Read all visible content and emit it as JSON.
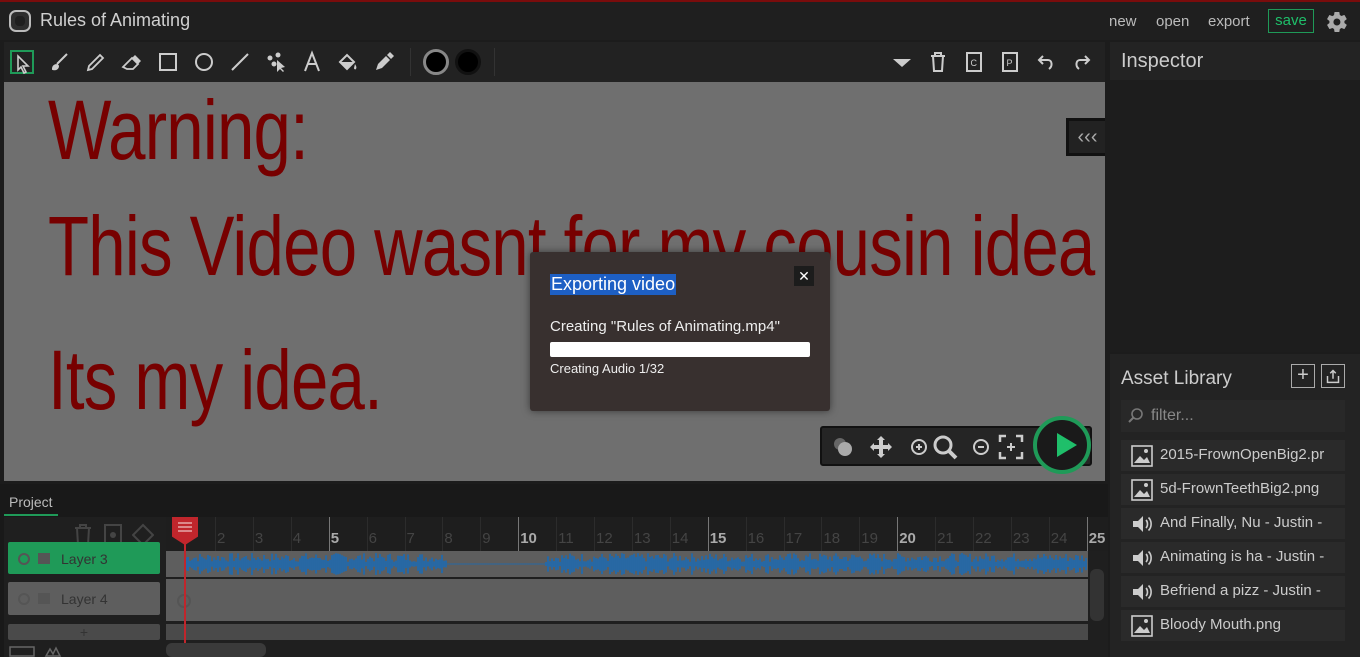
{
  "app": {
    "title": "Rules of Animating",
    "menu": [
      "new",
      "open",
      "export"
    ],
    "save_label": "save",
    "accent_color": "#1f9a58",
    "border_color": "#7a0c0c"
  },
  "toolbar": {
    "tools": [
      "cursor-select-icon",
      "brush-icon",
      "pencil-icon",
      "eraser-icon",
      "rectangle-icon",
      "ellipse-icon",
      "line-icon",
      "path-edit-icon",
      "text-icon",
      "fill-bucket-icon",
      "eyedropper-icon"
    ],
    "fill_color": "#000000",
    "stroke_color": "#000000",
    "right_tools": [
      "dropdown-icon",
      "trash-icon",
      "copy-icon",
      "paste-icon",
      "undo-icon",
      "redo-icon"
    ]
  },
  "canvas": {
    "lines": [
      "Warning:",
      "This Video wasnt for my cousin idea ...",
      "Its my idea."
    ],
    "text_color": "#700000",
    "collapse_label": "‹‹‹"
  },
  "export_modal": {
    "title": "Exporting video",
    "message": "Creating \"Rules of Animating.mp4\"",
    "status": "Creating Audio 1/32",
    "progress_fraction": 0.0,
    "close_label": "✕"
  },
  "inspector": {
    "title": "Inspector"
  },
  "asset_library": {
    "title": "Asset Library",
    "filter_placeholder": "filter...",
    "items": [
      {
        "label": "2015-FrownOpenBig2.pr",
        "icon": "image-icon"
      },
      {
        "label": "5d-FrownTeethBig2.png",
        "icon": "image-icon"
      },
      {
        "label": "And Finally, Nu - Justin -",
        "icon": "speaker-icon"
      },
      {
        "label": "Animating is ha - Justin -",
        "icon": "speaker-icon"
      },
      {
        "label": "Befriend a pizz - Justin -",
        "icon": "speaker-icon"
      },
      {
        "label": "Bloody Mouth.png",
        "icon": "image-icon"
      }
    ]
  },
  "timeline": {
    "tab": "Project",
    "layers": [
      {
        "label": "Layer 3",
        "active": true
      },
      {
        "label": "Layer 4",
        "active": false
      }
    ],
    "add_layer_label": "+",
    "ruler": [
      {
        "n": "2",
        "major": false
      },
      {
        "n": "3",
        "major": false
      },
      {
        "n": "4",
        "major": false
      },
      {
        "n": "5",
        "major": true
      },
      {
        "n": "6",
        "major": false
      },
      {
        "n": "7",
        "major": false
      },
      {
        "n": "8",
        "major": false
      },
      {
        "n": "9",
        "major": false
      },
      {
        "n": "10",
        "major": true
      },
      {
        "n": "11",
        "major": false
      },
      {
        "n": "12",
        "major": false
      },
      {
        "n": "13",
        "major": false
      },
      {
        "n": "14",
        "major": false
      },
      {
        "n": "15",
        "major": true
      },
      {
        "n": "16",
        "major": false
      },
      {
        "n": "17",
        "major": false
      },
      {
        "n": "18",
        "major": false
      },
      {
        "n": "19",
        "major": false
      },
      {
        "n": "20",
        "major": true
      },
      {
        "n": "21",
        "major": false
      },
      {
        "n": "22",
        "major": false
      },
      {
        "n": "23",
        "major": false
      },
      {
        "n": "24",
        "major": false
      },
      {
        "n": "25",
        "major": true
      }
    ]
  }
}
